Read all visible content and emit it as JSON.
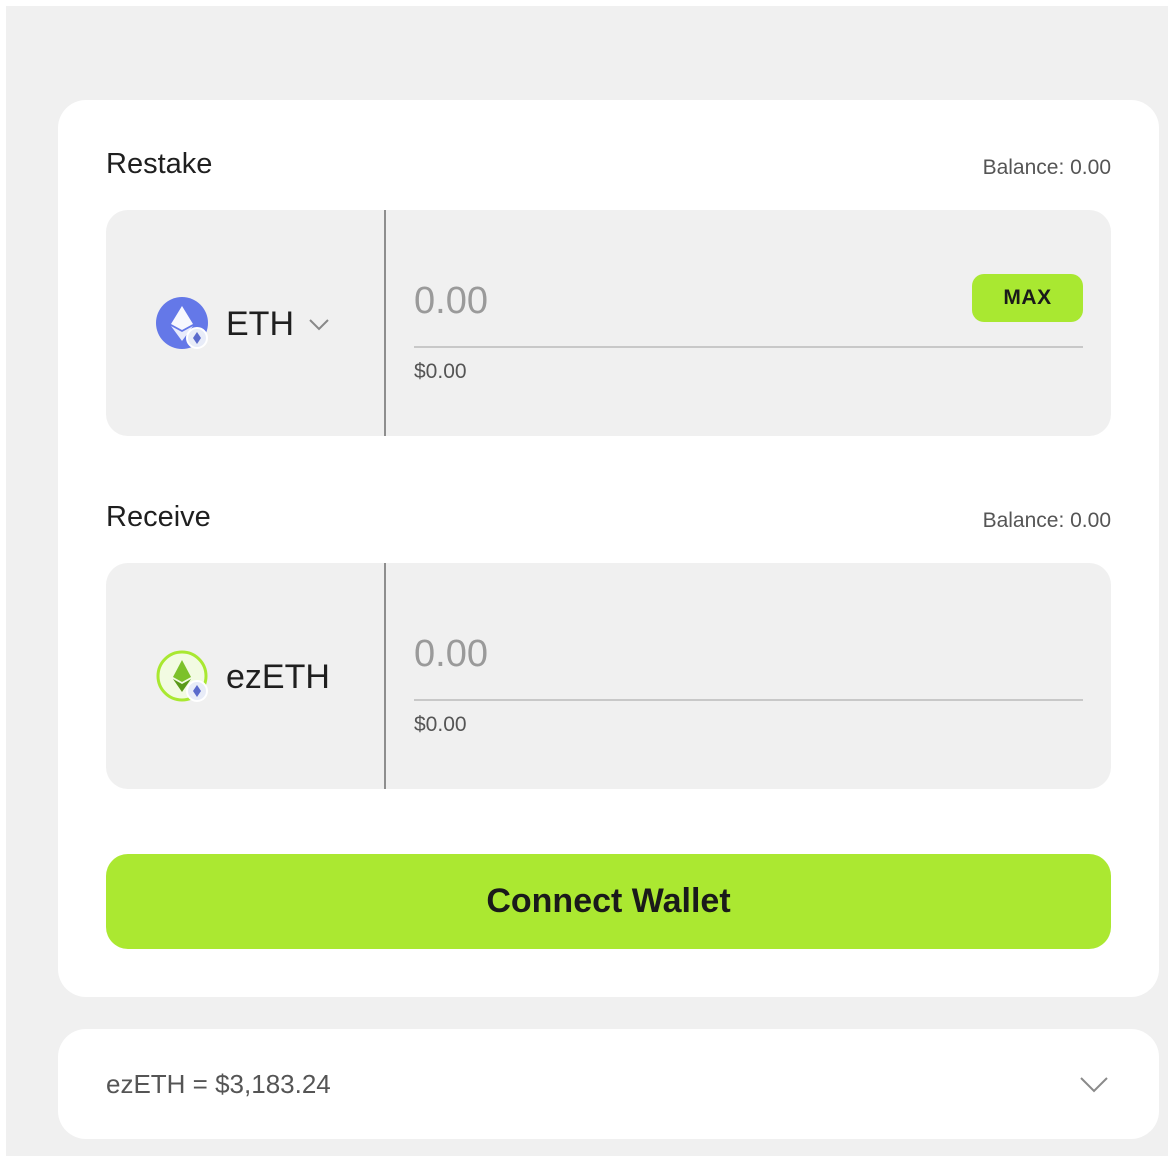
{
  "restake": {
    "label": "Restake",
    "balance": "Balance: 0.00",
    "token": {
      "name": "ETH",
      "icon": "ethereum-icon"
    },
    "amount": "0.00",
    "usd": "$0.00",
    "max_label": "MAX"
  },
  "receive": {
    "label": "Receive",
    "balance": "Balance: 0.00",
    "token": {
      "name": "ezETH",
      "icon": "ezeth-icon"
    },
    "amount": "0.00",
    "usd": "$0.00"
  },
  "connect_label": "Connect Wallet",
  "rate": {
    "text": "ezETH = $3,183.24"
  },
  "colors": {
    "accent": "#abe831",
    "eth_blue": "#6478e8",
    "ezeth_green": "#a9e831"
  }
}
